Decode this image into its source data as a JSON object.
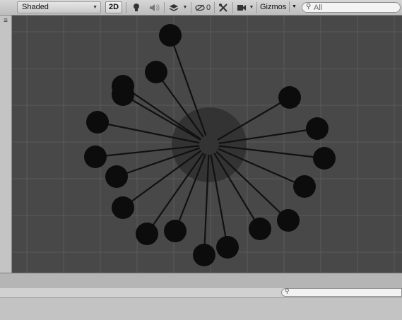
{
  "toolbar": {
    "shading_mode": "Shaded",
    "mode_2d": "2D",
    "hidden_count": "0",
    "gizmos": "Gizmos",
    "search_placeholder": "All",
    "icons": [
      "light-bulb-icon",
      "audio-icon",
      "effects-layers-icon",
      "hidden-objects-icon",
      "tools-icon",
      "camera-icon",
      "search-icon"
    ]
  },
  "scene": {
    "background_color": "#484848",
    "grid_color": "#5a5a5a",
    "center_disc_color": "#333333",
    "node_color": "#0c0c0c",
    "line_color": "#111111",
    "node_count": 18
  },
  "bottom": {
    "search_placeholder": ""
  }
}
